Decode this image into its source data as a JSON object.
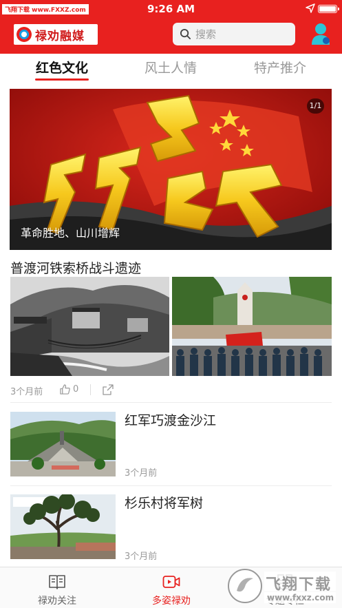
{
  "status_bar": {
    "watermark": "飞翔下载 www.FXXZ.com",
    "time": "9:26 AM"
  },
  "header": {
    "logo_text": "禄劝融媒",
    "search_placeholder": "搜索"
  },
  "tabs": [
    {
      "label": "红色文化",
      "active": true
    },
    {
      "label": "风土人情",
      "active": false
    },
    {
      "label": "特产推介",
      "active": false
    }
  ],
  "banner": {
    "caption": "革命胜地、山川增辉",
    "pager": "1/1"
  },
  "articles": [
    {
      "title": "普渡河铁索桥战斗遗迹",
      "time": "3个月前",
      "likes": "0"
    },
    {
      "title": "红军巧渡金沙江",
      "time": "3个月前"
    },
    {
      "title": "杉乐村将军树",
      "time": "3个月前"
    }
  ],
  "bottom_nav": [
    {
      "label": "禄劝关注",
      "icon": "book-icon",
      "active": false
    },
    {
      "label": "多姿禄劝",
      "icon": "video-icon",
      "active": true
    },
    {
      "label": "专题专栏",
      "icon": "grid-icon",
      "active": false
    }
  ],
  "watermark_bottom": {
    "text": "飞翔下载",
    "url": "www.fxxz.com"
  },
  "colors": {
    "brand_red": "#e8211f",
    "text_dark": "#222222",
    "text_muted": "#999999"
  }
}
